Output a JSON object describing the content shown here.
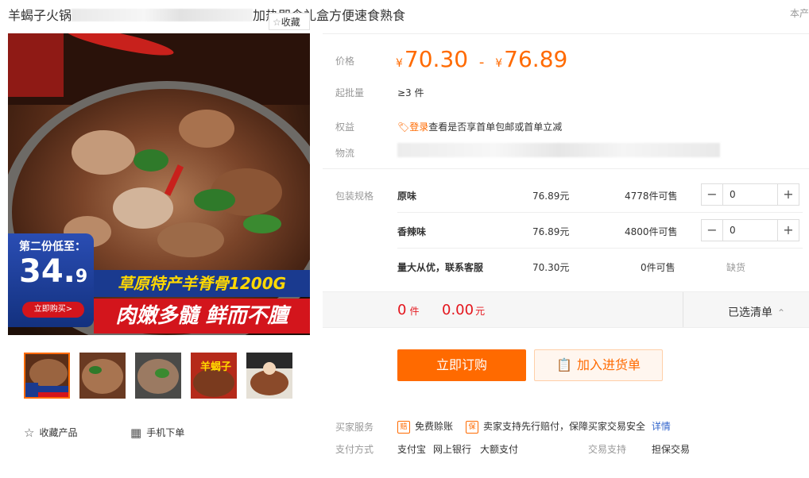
{
  "title": {
    "prefix": "羊蝎子火锅",
    "suffix": "加热即食礼盒方便速食熟食"
  },
  "origin_label": "本产",
  "fav_chip": "收藏",
  "promo": {
    "badge_line": "第二份低至：",
    "big_price": "34.",
    "small_price": "9",
    "buy_btn": "立即购买>",
    "banner1": "草原特产羊脊骨1200G",
    "banner2": "肉嫩多髓 鲜而不膻"
  },
  "thumbs": [
    {
      "selected": true
    },
    {
      "selected": false
    },
    {
      "selected": false
    },
    {
      "selected": false
    },
    {
      "selected": false
    }
  ],
  "actions": {
    "favorite": "收藏产品",
    "mobile": "手机下单"
  },
  "price": {
    "label": "价格",
    "symbol": "¥",
    "low": "70.30",
    "high": "76.89",
    "dash": "-"
  },
  "moq": {
    "label": "起批量",
    "value": "≥3 件"
  },
  "rights": {
    "label": "权益",
    "login": "登录",
    "text": "查看是否享首单包邮或首单立减"
  },
  "logistics": {
    "label": "物流"
  },
  "spec": {
    "label": "包装规格",
    "rows": [
      {
        "name": "原味",
        "price": "76.89元",
        "stock": "4778件可售",
        "qty": "0"
      },
      {
        "name": "香辣味",
        "price": "76.89元",
        "stock": "4800件可售",
        "qty": "0"
      },
      {
        "name": "量大从优，联系客服",
        "price": "70.30元",
        "stock": "0件可售",
        "status": "缺货"
      }
    ]
  },
  "summary": {
    "count": "0",
    "count_unit": "件",
    "amount": "0.00",
    "amount_unit": "元",
    "list_label": "已选清单",
    "list_caret": "⌃"
  },
  "buttons": {
    "order": "立即订购",
    "cart": "加入进货单"
  },
  "services": {
    "label": "买家服务",
    "s1_badge": "赔",
    "s1": "免费赊账",
    "s2_badge": "保",
    "s2": "卖家支持先行赔付，保障买家交易安全",
    "s2_link": "详情"
  },
  "payment": {
    "label": "支付方式",
    "methods": [
      "支付宝",
      "网上银行",
      "大额支付"
    ]
  },
  "trade": {
    "label": "交易支持",
    "value": "担保交易"
  },
  "colors": {
    "accent": "#ff6a00",
    "price_red": "#e4161d",
    "banner_blue": "#1a3a8f",
    "banner_red": "#d3151c",
    "banner_yellow": "#ffd800"
  }
}
